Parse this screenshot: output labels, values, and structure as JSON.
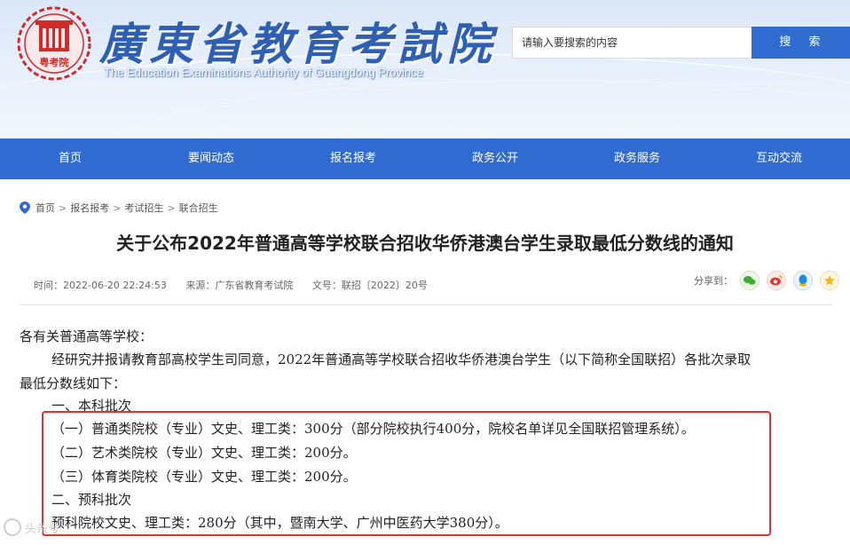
{
  "header": {
    "title": "廣東省教育考試院",
    "subtitle": "The Education Examinations Authority of Guangdong Province",
    "emblem_text": "粤考院",
    "search_placeholder": "请输入要搜索的内容",
    "search_button": "搜 索"
  },
  "nav": {
    "items": [
      {
        "label": "首页"
      },
      {
        "label": "要闻动态"
      },
      {
        "label": "报名报考"
      },
      {
        "label": "政务公开"
      },
      {
        "label": "政务服务"
      },
      {
        "label": "互动交流"
      }
    ]
  },
  "breadcrumb": {
    "items": [
      "首页",
      "报名报考",
      "考试招生",
      "联合招生"
    ],
    "separator": ">"
  },
  "article": {
    "title": "关于公布2022年普通高等学校联合招收华侨港澳台学生录取最低分数线的通知",
    "time": "时间：2022-06-20 22:24:53",
    "source": "来源：广东省教育考试院",
    "doc_no": "文号：联招〔2022〕20号",
    "share_label": "分享到：",
    "share_icons": [
      "wechat-icon",
      "weibo-icon",
      "qq-icon",
      "qzone-icon"
    ],
    "lines": {
      "greeting": "各有关普通高等学校：",
      "p1a": "经研究并报请教育部高校学生司同意，2022年普通高等学校联合招收华侨港澳台学生（以下简称全国联招）各批次录取",
      "p1b": "最低分数线如下：",
      "sec1": "一、本科批次",
      "item1": "（一）普通类院校（专业）文史、理工类：300分（部分院校执行400分，院校名单详见全国联招管理系统）。",
      "item2": "（二）艺术类院校（专业）文史、理工类：200分。",
      "item3": "（三）体育类院校（专业）文史、理工类：200分。",
      "sec2": "二、预科批次",
      "item4": "预科院校文史、理工类：280分（其中，暨南大学、广州中医药大学380分）。"
    }
  },
  "watermark": "头条号",
  "colors": {
    "brand_blue": "#2f6bd0",
    "highlight_red": "#e03030"
  }
}
